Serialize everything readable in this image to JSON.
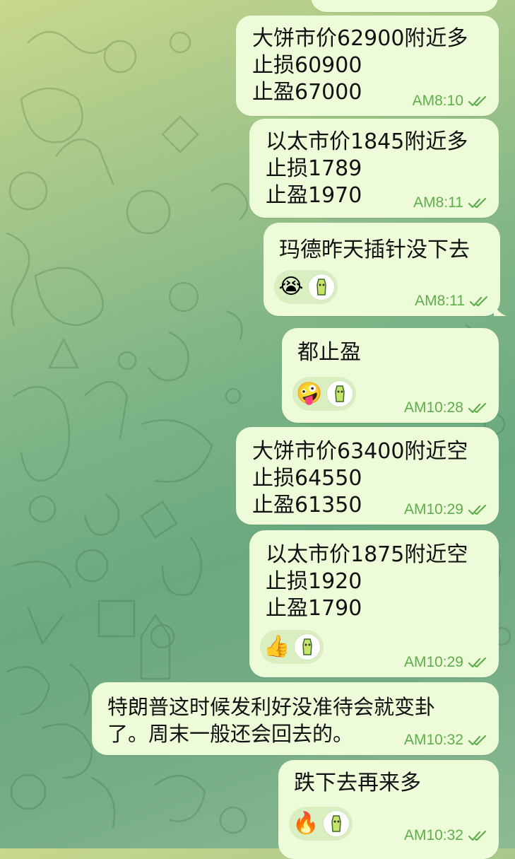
{
  "messages": [
    {
      "id": "m0",
      "text": "",
      "time": ""
    },
    {
      "id": "m1",
      "text": "大饼市价62900附近多\n止损60900\n止盈67000",
      "time": "AM8:10"
    },
    {
      "id": "m2",
      "text": "以太市价1845附近多\n止损1789\n止盈1970",
      "time": "AM8:11"
    },
    {
      "id": "m3",
      "text": "玛德昨天插针没下去",
      "time": "AM8:11",
      "reaction_emoji": "😭",
      "reaction_emoji_name": "loudly-crying-face-emoji"
    },
    {
      "id": "m4",
      "text": "都止盈",
      "time": "AM10:28",
      "reaction_emoji": "🤪",
      "reaction_emoji_name": "zany-face-emoji"
    },
    {
      "id": "m5",
      "text": "大饼市价63400附近空\n止损64550\n止盈61350",
      "time": "AM10:29"
    },
    {
      "id": "m6",
      "text": "以太市价1875附近空\n止损1920\n止盈1790",
      "time": "AM10:29",
      "reaction_emoji": "👍",
      "reaction_emoji_name": "thumbs-up-emoji"
    },
    {
      "id": "m7",
      "text": "特朗普这时候发利好没准待会就变卦\n了。周末一般还会回去的。",
      "time": "AM10:32"
    },
    {
      "id": "m8",
      "text": "跌下去再来多",
      "time": "AM10:32",
      "reaction_emoji": "🔥",
      "reaction_emoji_name": "fire-emoji"
    }
  ],
  "colors": {
    "bubble": "#eefbd9",
    "time_and_checks": "#5fae4b",
    "reaction_pill": "#d9efc2"
  },
  "icons": {
    "read_receipt": "double-check-icon",
    "reactor_avatar": "user-avatar-icon"
  }
}
